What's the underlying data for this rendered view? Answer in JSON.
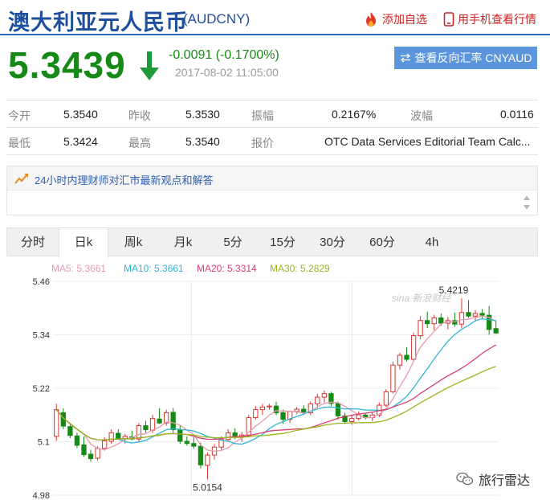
{
  "header": {
    "title_cn": "澳大利亚元人民币",
    "code": "(AUDCNY)",
    "add_watch": "添加自选",
    "mobile_view": "用手机查看行情"
  },
  "quote": {
    "price": "5.3439",
    "change": "-0.0091 (-0.1700%)",
    "timestamp": "2017-08-02 11:05:00",
    "reverse_button": "查看反向汇率 CNYAUD",
    "rows": [
      [
        {
          "label": "今开",
          "value": "5.3540"
        },
        {
          "label": "昨收",
          "value": "5.3530"
        },
        {
          "label": "振幅",
          "value": "0.2167%"
        },
        {
          "label": "波幅",
          "value": "0.0116"
        }
      ],
      [
        {
          "label": "最低",
          "value": "5.3424"
        },
        {
          "label": "最高",
          "value": "5.3540"
        },
        {
          "label": "报价",
          "value": "OTC Data Services Editorial Team Calc..."
        }
      ]
    ]
  },
  "opinion": {
    "text": "24小时内理财师对汇市最新观点和解答"
  },
  "tabs": [
    "分时",
    "日k",
    "周k",
    "月k",
    "5分",
    "15分",
    "30分",
    "60分",
    "4h"
  ],
  "active_tab": "日k",
  "colors": {
    "brand_blue": "#1d4f9c",
    "up": "#d9352f",
    "down": "#168a16",
    "ma5": "#e59bb0",
    "ma10": "#2fb6d6",
    "ma20": "#d6406e",
    "ma30": "#9ab51e"
  },
  "chart_data": {
    "type": "candlestick",
    "ma_labels": [
      "MA5: 5.3661",
      "MA10: 5.3661",
      "MA20: 5.3314",
      "MA30: 5.2829"
    ],
    "y_ticks": [
      "5.46",
      "5.34",
      "5.22",
      "5.1",
      "4.98"
    ],
    "ylim": [
      4.98,
      5.46
    ],
    "grid": true,
    "annotations": {
      "high": "5.4219",
      "low": "5.0154"
    },
    "candles": [
      {
        "o": 5.112,
        "h": 5.185,
        "l": 5.102,
        "c": 5.172
      },
      {
        "o": 5.165,
        "h": 5.175,
        "l": 5.128,
        "c": 5.135
      },
      {
        "o": 5.134,
        "h": 5.142,
        "l": 5.108,
        "c": 5.114
      },
      {
        "o": 5.113,
        "h": 5.12,
        "l": 5.086,
        "c": 5.092
      },
      {
        "o": 5.093,
        "h": 5.112,
        "l": 5.066,
        "c": 5.071
      },
      {
        "o": 5.072,
        "h": 5.082,
        "l": 5.055,
        "c": 5.062
      },
      {
        "o": 5.063,
        "h": 5.09,
        "l": 5.058,
        "c": 5.085
      },
      {
        "o": 5.085,
        "h": 5.11,
        "l": 5.08,
        "c": 5.102
      },
      {
        "o": 5.101,
        "h": 5.128,
        "l": 5.095,
        "c": 5.12
      },
      {
        "o": 5.119,
        "h": 5.128,
        "l": 5.104,
        "c": 5.108
      },
      {
        "o": 5.107,
        "h": 5.118,
        "l": 5.096,
        "c": 5.112
      },
      {
        "o": 5.111,
        "h": 5.125,
        "l": 5.103,
        "c": 5.106
      },
      {
        "o": 5.106,
        "h": 5.142,
        "l": 5.1,
        "c": 5.136
      },
      {
        "o": 5.136,
        "h": 5.147,
        "l": 5.12,
        "c": 5.127
      },
      {
        "o": 5.126,
        "h": 5.16,
        "l": 5.12,
        "c": 5.152
      },
      {
        "o": 5.151,
        "h": 5.175,
        "l": 5.14,
        "c": 5.142
      },
      {
        "o": 5.142,
        "h": 5.172,
        "l": 5.136,
        "c": 5.165
      },
      {
        "o": 5.166,
        "h": 5.176,
        "l": 5.12,
        "c": 5.127
      },
      {
        "o": 5.126,
        "h": 5.137,
        "l": 5.095,
        "c": 5.101
      },
      {
        "o": 5.101,
        "h": 5.112,
        "l": 5.091,
        "c": 5.096
      },
      {
        "o": 5.096,
        "h": 5.11,
        "l": 5.084,
        "c": 5.09
      },
      {
        "o": 5.09,
        "h": 5.098,
        "l": 5.04,
        "c": 5.048
      },
      {
        "o": 5.047,
        "h": 5.076,
        "l": 5.015,
        "c": 5.07
      },
      {
        "o": 5.07,
        "h": 5.095,
        "l": 5.06,
        "c": 5.088
      },
      {
        "o": 5.088,
        "h": 5.112,
        "l": 5.08,
        "c": 5.106
      },
      {
        "o": 5.105,
        "h": 5.128,
        "l": 5.1,
        "c": 5.12
      },
      {
        "o": 5.12,
        "h": 5.13,
        "l": 5.106,
        "c": 5.112
      },
      {
        "o": 5.112,
        "h": 5.122,
        "l": 5.1,
        "c": 5.115
      },
      {
        "o": 5.115,
        "h": 5.16,
        "l": 5.11,
        "c": 5.154
      },
      {
        "o": 5.154,
        "h": 5.18,
        "l": 5.15,
        "c": 5.172
      },
      {
        "o": 5.172,
        "h": 5.185,
        "l": 5.16,
        "c": 5.178
      },
      {
        "o": 5.178,
        "h": 5.185,
        "l": 5.172,
        "c": 5.18
      },
      {
        "o": 5.18,
        "h": 5.19,
        "l": 5.16,
        "c": 5.165
      },
      {
        "o": 5.165,
        "h": 5.172,
        "l": 5.14,
        "c": 5.15
      },
      {
        "o": 5.15,
        "h": 5.17,
        "l": 5.142,
        "c": 5.168
      },
      {
        "o": 5.168,
        "h": 5.178,
        "l": 5.162,
        "c": 5.173
      },
      {
        "o": 5.173,
        "h": 5.182,
        "l": 5.16,
        "c": 5.165
      },
      {
        "o": 5.165,
        "h": 5.19,
        "l": 5.16,
        "c": 5.185
      },
      {
        "o": 5.185,
        "h": 5.208,
        "l": 5.176,
        "c": 5.2
      },
      {
        "o": 5.2,
        "h": 5.215,
        "l": 5.188,
        "c": 5.208
      },
      {
        "o": 5.208,
        "h": 5.212,
        "l": 5.18,
        "c": 5.186
      },
      {
        "o": 5.186,
        "h": 5.19,
        "l": 5.15,
        "c": 5.158
      },
      {
        "o": 5.158,
        "h": 5.165,
        "l": 5.14,
        "c": 5.145
      },
      {
        "o": 5.145,
        "h": 5.16,
        "l": 5.138,
        "c": 5.152
      },
      {
        "o": 5.152,
        "h": 5.168,
        "l": 5.148,
        "c": 5.16
      },
      {
        "o": 5.16,
        "h": 5.165,
        "l": 5.15,
        "c": 5.154
      },
      {
        "o": 5.154,
        "h": 5.165,
        "l": 5.146,
        "c": 5.16
      },
      {
        "o": 5.16,
        "h": 5.188,
        "l": 5.155,
        "c": 5.182
      },
      {
        "o": 5.182,
        "h": 5.218,
        "l": 5.178,
        "c": 5.212
      },
      {
        "o": 5.212,
        "h": 5.28,
        "l": 5.208,
        "c": 5.272
      },
      {
        "o": 5.272,
        "h": 5.3,
        "l": 5.262,
        "c": 5.294
      },
      {
        "o": 5.294,
        "h": 5.312,
        "l": 5.28,
        "c": 5.285
      },
      {
        "o": 5.285,
        "h": 5.345,
        "l": 5.28,
        "c": 5.338
      },
      {
        "o": 5.338,
        "h": 5.382,
        "l": 5.33,
        "c": 5.372
      },
      {
        "o": 5.372,
        "h": 5.392,
        "l": 5.355,
        "c": 5.365
      },
      {
        "o": 5.365,
        "h": 5.385,
        "l": 5.35,
        "c": 5.378
      },
      {
        "o": 5.378,
        "h": 5.388,
        "l": 5.36,
        "c": 5.366
      },
      {
        "o": 5.366,
        "h": 5.38,
        "l": 5.352,
        "c": 5.372
      },
      {
        "o": 5.372,
        "h": 5.39,
        "l": 5.358,
        "c": 5.364
      },
      {
        "o": 5.364,
        "h": 5.422,
        "l": 5.355,
        "c": 5.39
      },
      {
        "o": 5.39,
        "h": 5.418,
        "l": 5.378,
        "c": 5.382
      },
      {
        "o": 5.382,
        "h": 5.395,
        "l": 5.37,
        "c": 5.388
      },
      {
        "o": 5.388,
        "h": 5.398,
        "l": 5.375,
        "c": 5.384
      },
      {
        "o": 5.384,
        "h": 5.405,
        "l": 5.34,
        "c": 5.352
      },
      {
        "o": 5.354,
        "h": 5.372,
        "l": 5.342,
        "c": 5.344
      }
    ]
  }
}
